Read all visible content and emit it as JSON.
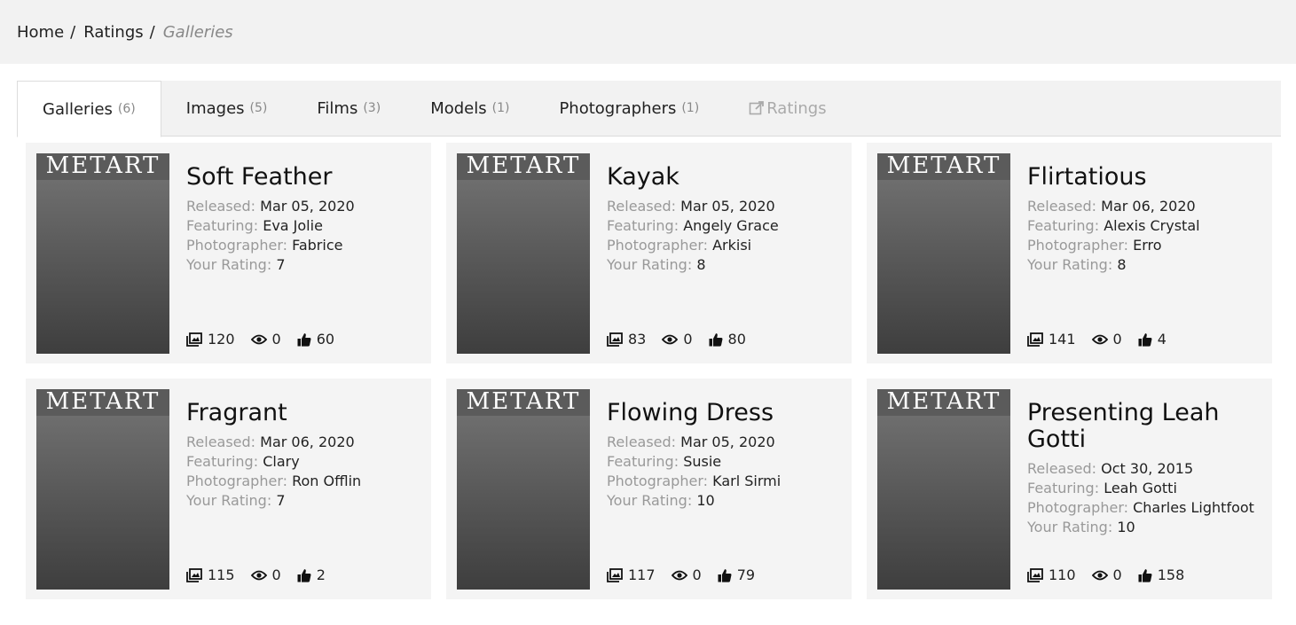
{
  "breadcrumb": {
    "home": "Home",
    "ratings": "Ratings",
    "current": "Galleries",
    "separator": "/"
  },
  "tabs": [
    {
      "label": "Galleries",
      "count": "(6)"
    },
    {
      "label": "Images",
      "count": "(5)"
    },
    {
      "label": "Films",
      "count": "(3)"
    },
    {
      "label": "Models",
      "count": "(1)"
    },
    {
      "label": "Photographers",
      "count": "(1)"
    },
    {
      "label": "Ratings",
      "count": ""
    }
  ],
  "labels": {
    "released": "Released:",
    "featuring": "Featuring:",
    "photographer": "Photographer:",
    "rating": "Your Rating:"
  },
  "cover_masthead": "METART",
  "galleries": [
    {
      "title": "Soft Feather",
      "released": "Mar 05, 2020",
      "featuring": "Eva Jolie",
      "photographer": "Fabrice",
      "rating": "7",
      "images": "120",
      "views": "0",
      "likes": "60"
    },
    {
      "title": "Kayak",
      "released": "Mar 05, 2020",
      "featuring": "Angely Grace",
      "photographer": "Arkisi",
      "rating": "8",
      "images": "83",
      "views": "0",
      "likes": "80"
    },
    {
      "title": "Flirtatious",
      "released": "Mar 06, 2020",
      "featuring": "Alexis Crystal",
      "photographer": "Erro",
      "rating": "8",
      "images": "141",
      "views": "0",
      "likes": "4"
    },
    {
      "title": "Fragrant",
      "released": "Mar 06, 2020",
      "featuring": "Clary",
      "photographer": "Ron Offlin",
      "rating": "7",
      "images": "115",
      "views": "0",
      "likes": "2"
    },
    {
      "title": "Flowing Dress",
      "released": "Mar 05, 2020",
      "featuring": "Susie",
      "photographer": "Karl Sirmi",
      "rating": "10",
      "images": "117",
      "views": "0",
      "likes": "79"
    },
    {
      "title": "Presenting Leah Gotti",
      "released": "Oct 30, 2015",
      "featuring": "Leah Gotti",
      "photographer": "Charles Lightfoot",
      "rating": "10",
      "images": "110",
      "views": "0",
      "likes": "158"
    }
  ]
}
